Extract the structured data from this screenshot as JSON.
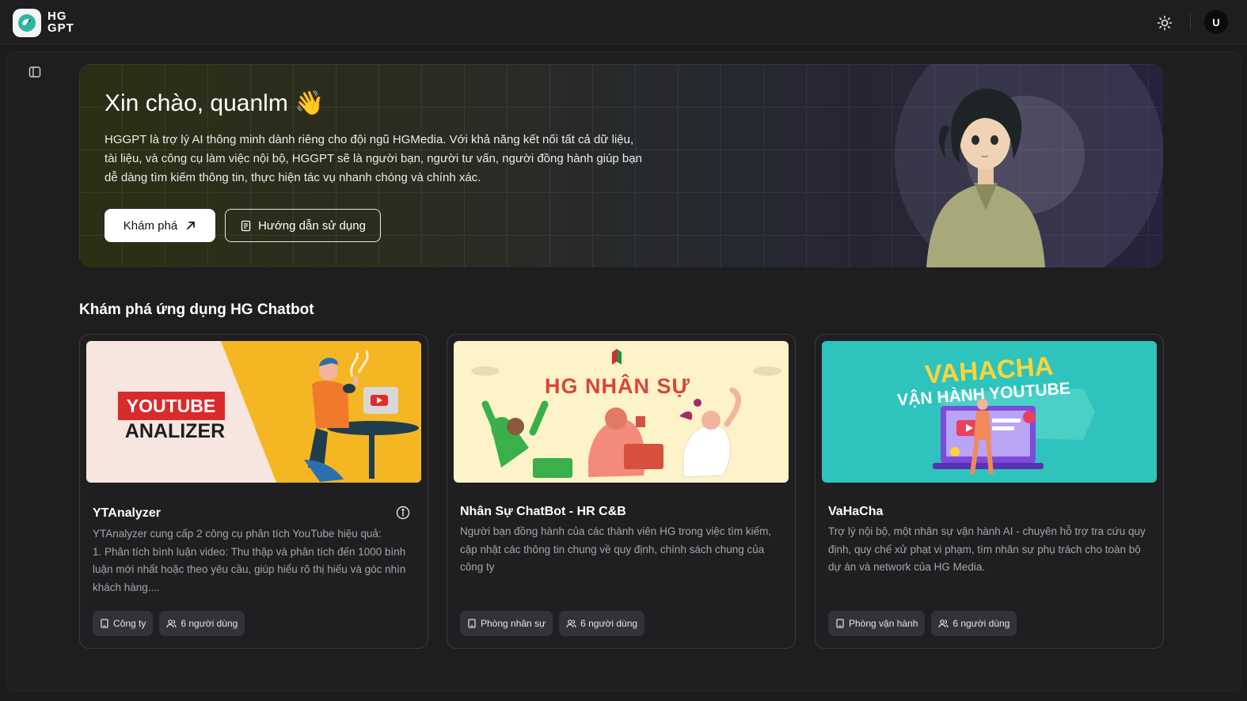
{
  "app": {
    "logo_line1": "HG",
    "logo_line2": "GPT",
    "user_initial": "U"
  },
  "hero": {
    "greeting": "Xin chào, quanlm 👋",
    "description": "HGGPT là trợ lý AI thông minh dành riêng cho đội ngũ HGMedia. Với khả năng kết nối tất cả dữ liệu, tài liệu, và công cụ làm việc nội bộ, HGGPT sẽ là người bạn, người tư vấn, người đồng hành giúp bạn dễ dàng tìm kiếm thông tin, thực hiện tác vụ nhanh chóng và chính xác.",
    "explore_label": "Khám phá",
    "guide_label": "Hướng dẫn sử dụng"
  },
  "section": {
    "title": "Khám phá ứng dụng HG Chatbot"
  },
  "cards": [
    {
      "title": "YTAnalyzer",
      "description": "YTAnalyzer cung cấp 2 công cụ phân tích YouTube hiệu quả:\n1. Phân tích bình luận video: Thu thập và phân tích đến 1000 bình luận mới nhất hoặc theo yêu cầu, giúp hiểu rõ thị hiếu và góc nhìn khách hàng....",
      "image_line1": "YOUTUBE",
      "image_line2": "ANALIZER",
      "tag_dept": "Công ty",
      "tag_users": "6 người dùng"
    },
    {
      "title": "Nhân Sự ChatBot - HR C&B",
      "description": "Người bạn đồng hành của các thành viên HG trong việc tìm kiếm, cập nhật các thông tin chung về quy định, chính sách chung của công ty",
      "image_line1": "HG NHÂN SỰ",
      "tag_dept": "Phòng nhân sự",
      "tag_users": "6 người dùng"
    },
    {
      "title": "VaHaCha",
      "description": "Trợ lý nội bộ, một nhân sự vận hành AI - chuyên hỗ trợ tra cứu quy định, quy chế xử phạt vi phạm, tìm nhân sự phụ trách cho toàn bộ dự án và network của HG Media.",
      "image_line1": "VAHACHA",
      "image_line2": "VẬN HÀNH YOUTUBE",
      "tag_dept": "Phòng vận hành",
      "tag_users": "6 người dùng"
    }
  ],
  "colors": {
    "background": "#1c1c1e",
    "card_border": "#3a3a3d",
    "tag_bg": "#323239",
    "ytanalyzer_yellow": "#f5b623",
    "hr_bg": "#fdf3c8",
    "vahacha_teal": "#2ec4bd"
  }
}
